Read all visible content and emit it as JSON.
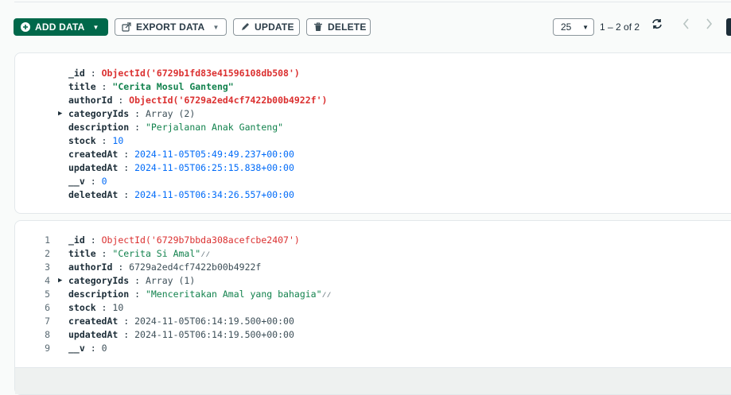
{
  "toolbar": {
    "add_data": "ADD DATA",
    "export_data": "EXPORT DATA",
    "update": "UPDATE",
    "delete": "DELETE",
    "page_size": "25",
    "range": "1 – 2 of 2"
  },
  "icons": {
    "add": "plus-circle-icon",
    "export": "export-icon",
    "update": "pencil-icon",
    "delete": "trash-icon",
    "refresh": "refresh-icon",
    "prev": "chevron-left-icon",
    "next": "chevron-right-icon"
  },
  "colors": {
    "primary": "#00684a",
    "string": "#12824d",
    "objectid": "#db3030",
    "number": "#016bf8"
  },
  "doc1": {
    "id_key": "_id",
    "id_val": "ObjectId('6729b1fd83e41596108db508')",
    "title_key": "title",
    "title_val": "\"Cerita Mosul Ganteng\"",
    "author_key": "authorId",
    "author_val": "ObjectId('6729a2ed4cf7422b00b4922f')",
    "cat_key": "categoryIds",
    "cat_val": "Array (2)",
    "desc_key": "description",
    "desc_val": "\"Perjalanan Anak Ganteng\"",
    "stock_key": "stock",
    "stock_val": "10",
    "created_key": "createdAt",
    "created_val": "2024-11-05T05:49:49.237+00:00",
    "updated_key": "updatedAt",
    "updated_val": "2024-11-05T06:25:15.838+00:00",
    "v_key": "__v",
    "v_val": "0",
    "deleted_key": "deletedAt",
    "deleted_val": "2024-11-05T06:34:26.557+00:00"
  },
  "doc2": {
    "lines": [
      "1",
      "2",
      "3",
      "4",
      "5",
      "6",
      "7",
      "8",
      "9"
    ],
    "id_key": "_id",
    "id_val": "ObjectId('6729b7bbda308acefcbe2407')",
    "title_key": "title",
    "title_val": "\"Cerita Si Amal\"",
    "author_key": "authorId",
    "author_val": "6729a2ed4cf7422b00b4922f",
    "cat_key": "categoryIds",
    "cat_val": "Array (1)",
    "desc_key": "description",
    "desc_val": "\"Menceritakan Amal yang bahagia\"",
    "stock_key": "stock",
    "stock_val": "10",
    "created_key": "createdAt",
    "created_val": "2024-11-05T06:14:19.500+00:00",
    "updated_key": "updatedAt",
    "updated_val": "2024-11-05T06:14:19.500+00:00",
    "v_key": "__v",
    "v_val": "0"
  }
}
